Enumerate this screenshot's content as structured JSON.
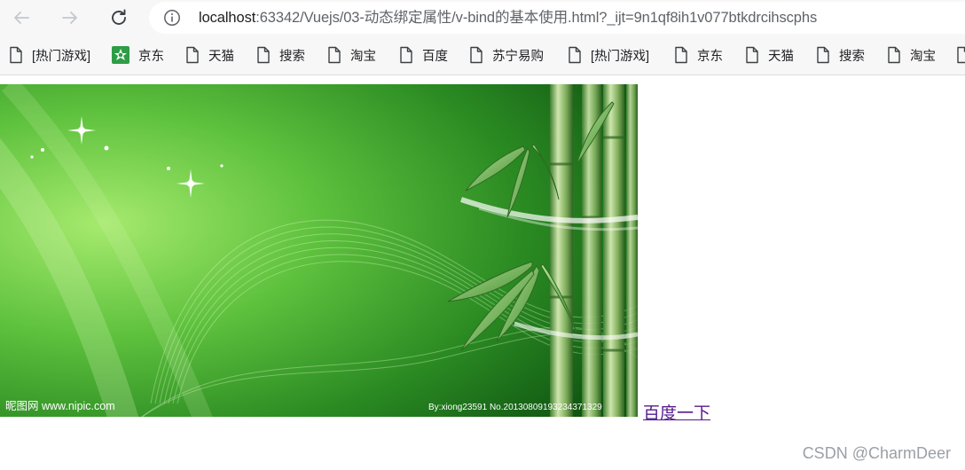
{
  "browser": {
    "url_host": "localhost",
    "url_rest": ":63342/Vuejs/03-动态绑定属性/v-bind的基本使用.html?_ijt=9n1qf8ih1v077btkdrcihscphs",
    "back_icon": "back-arrow-icon",
    "forward_icon": "forward-arrow-icon",
    "reload_icon": "reload-icon",
    "info_icon": "info-icon"
  },
  "bookmarks": [
    {
      "label": "[热门游戏]",
      "icon": "page-icon"
    },
    {
      "label": "京东",
      "icon": "jd-icon"
    },
    {
      "label": "天猫",
      "icon": "page-icon"
    },
    {
      "label": "搜索",
      "icon": "page-icon"
    },
    {
      "label": "淘宝",
      "icon": "page-icon"
    },
    {
      "label": "百度",
      "icon": "page-icon"
    },
    {
      "label": "苏宁易购",
      "icon": "page-icon"
    },
    {
      "label": "[热门游戏]",
      "icon": "page-icon"
    },
    {
      "label": "京东",
      "icon": "page-icon"
    },
    {
      "label": "天猫",
      "icon": "page-icon"
    },
    {
      "label": "搜索",
      "icon": "page-icon"
    },
    {
      "label": "淘宝",
      "icon": "page-icon"
    }
  ],
  "content": {
    "image_watermark_left": "昵图网 www.nipic.com",
    "image_watermark_right": "By:xiong23591  No.20130809193234371329",
    "link_text": "百度一下",
    "link_color": "#551a8b"
  },
  "footer": {
    "watermark": "CSDN @CharmDeer"
  }
}
